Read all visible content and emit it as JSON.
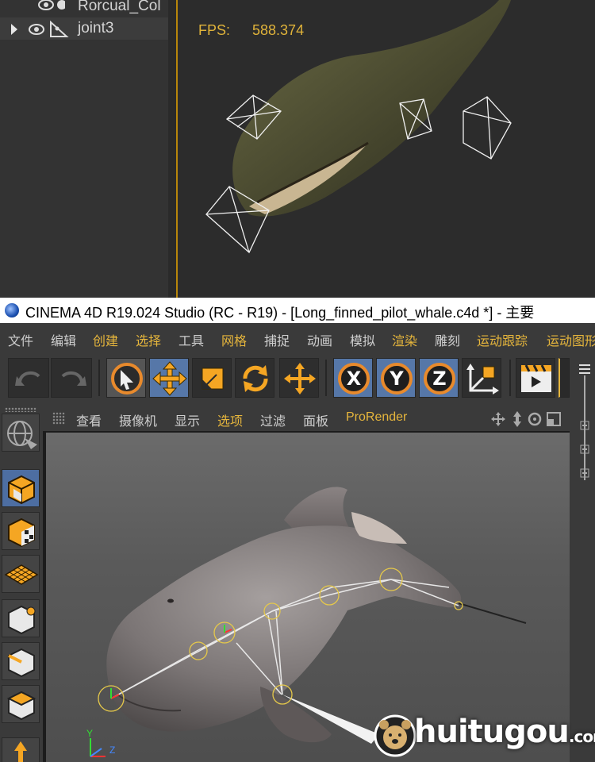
{
  "top_crop": {
    "objects": [
      {
        "name": "Rorcual_Col"
      },
      {
        "name": "joint3"
      }
    ],
    "fps_label": "FPS:",
    "fps_value": "588.374"
  },
  "titlebar": {
    "title": "CINEMA 4D R19.024 Studio (RC - R19) - [Long_finned_pilot_whale.c4d *] - 主要"
  },
  "menu": {
    "items": [
      {
        "label": "文件",
        "highlight": false
      },
      {
        "label": "编辑",
        "highlight": false
      },
      {
        "label": "创建",
        "highlight": true
      },
      {
        "label": "选择",
        "highlight": true
      },
      {
        "label": "工具",
        "highlight": false
      },
      {
        "label": "网格",
        "highlight": true
      },
      {
        "label": "捕捉",
        "highlight": false
      },
      {
        "label": "动画",
        "highlight": false
      },
      {
        "label": "模拟",
        "highlight": false
      },
      {
        "label": "渲染",
        "highlight": true
      },
      {
        "label": "雕刻",
        "highlight": false
      },
      {
        "label": "运动跟踪",
        "highlight": true
      },
      {
        "label": "运动图形",
        "highlight": true
      }
    ]
  },
  "toolbar": {
    "axis_x": "X",
    "axis_y": "Y",
    "axis_z": "Z"
  },
  "view_menu": {
    "items": [
      {
        "label": "查看",
        "highlight": false
      },
      {
        "label": "摄像机",
        "highlight": false
      },
      {
        "label": "显示",
        "highlight": false
      },
      {
        "label": "选项",
        "highlight": true
      },
      {
        "label": "过滤",
        "highlight": false
      },
      {
        "label": "面板",
        "highlight": false
      },
      {
        "label": "ProRender",
        "highlight": true
      }
    ]
  },
  "viewport": {
    "axis_y": "Y",
    "axis_z": "Z"
  },
  "watermark": {
    "brand": "huitugou",
    "suffix": ".com"
  },
  "colors": {
    "accent": "#e5b53c",
    "active_button": "#5677a8",
    "menu_text": "#cfcfcf"
  }
}
